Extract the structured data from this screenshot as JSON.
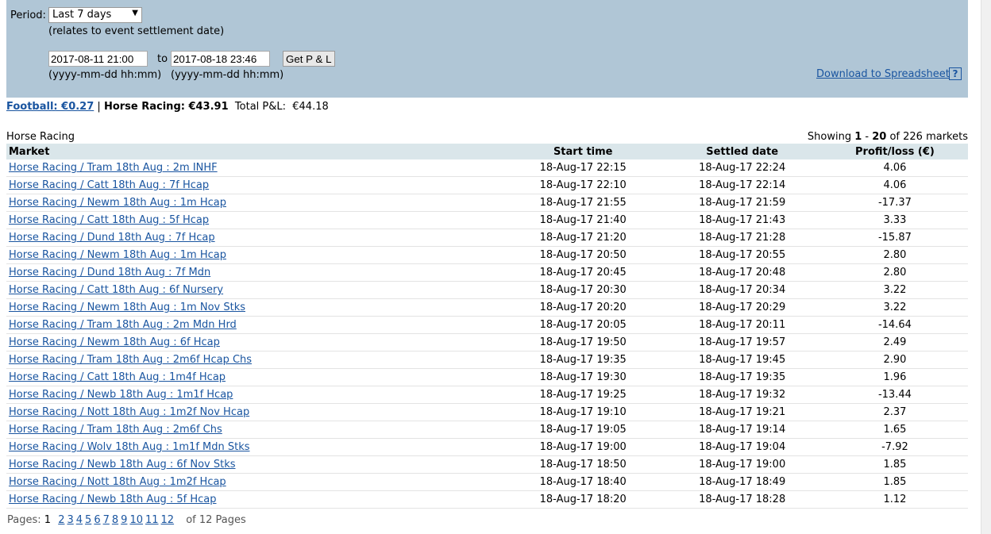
{
  "filter": {
    "period_label": "Period:",
    "period_value": "Last 7 days",
    "period_note": "(relates to event settlement date)",
    "from": "2017-08-11 21:00",
    "to_label": "to",
    "to": "2017-08-18 23:46",
    "format_hint": "(yyyy-mm-dd hh:mm)",
    "button": "Get P & L",
    "download": "Download to Spreadsheet",
    "help": "?"
  },
  "summary": {
    "football": "Football: €0.27",
    "sep": "|",
    "horse": "Horse Racing: €43.91",
    "total_label": "Total P&L:",
    "total": "€44.18"
  },
  "section": "Horse Racing",
  "showing": {
    "pre": "Showing ",
    "from": "1",
    "dash": " - ",
    "to": "20",
    "post": " of 226 markets"
  },
  "columns": [
    "Market",
    "Start time",
    "Settled date",
    "Profit/loss (€)"
  ],
  "rows": [
    [
      "Horse Racing / Tram 18th Aug : 2m INHF",
      "18-Aug-17 22:15",
      "18-Aug-17 22:24",
      "4.06"
    ],
    [
      "Horse Racing / Catt 18th Aug : 7f Hcap",
      "18-Aug-17 22:10",
      "18-Aug-17 22:14",
      "4.06"
    ],
    [
      "Horse Racing / Newm 18th Aug : 1m Hcap",
      "18-Aug-17 21:55",
      "18-Aug-17 21:59",
      "-17.37"
    ],
    [
      "Horse Racing / Catt 18th Aug : 5f Hcap",
      "18-Aug-17 21:40",
      "18-Aug-17 21:43",
      "3.33"
    ],
    [
      "Horse Racing / Dund 18th Aug : 7f Hcap",
      "18-Aug-17 21:20",
      "18-Aug-17 21:28",
      "-15.87"
    ],
    [
      "Horse Racing / Newm 18th Aug : 1m Hcap",
      "18-Aug-17 20:50",
      "18-Aug-17 20:55",
      "2.80"
    ],
    [
      "Horse Racing / Dund 18th Aug : 7f Mdn",
      "18-Aug-17 20:45",
      "18-Aug-17 20:48",
      "2.80"
    ],
    [
      "Horse Racing / Catt 18th Aug : 6f Nursery",
      "18-Aug-17 20:30",
      "18-Aug-17 20:34",
      "3.22"
    ],
    [
      "Horse Racing / Newm 18th Aug : 1m Nov Stks",
      "18-Aug-17 20:20",
      "18-Aug-17 20:29",
      "3.22"
    ],
    [
      "Horse Racing / Tram 18th Aug : 2m Mdn Hrd",
      "18-Aug-17 20:05",
      "18-Aug-17 20:11",
      "-14.64"
    ],
    [
      "Horse Racing / Newm 18th Aug : 6f Hcap",
      "18-Aug-17 19:50",
      "18-Aug-17 19:57",
      "2.49"
    ],
    [
      "Horse Racing / Tram 18th Aug : 2m6f Hcap Chs",
      "18-Aug-17 19:35",
      "18-Aug-17 19:45",
      "2.90"
    ],
    [
      "Horse Racing / Catt 18th Aug : 1m4f Hcap",
      "18-Aug-17 19:30",
      "18-Aug-17 19:35",
      "1.96"
    ],
    [
      "Horse Racing / Newb 18th Aug : 1m1f Hcap",
      "18-Aug-17 19:25",
      "18-Aug-17 19:32",
      "-13.44"
    ],
    [
      "Horse Racing / Nott 18th Aug : 1m2f Nov Hcap",
      "18-Aug-17 19:10",
      "18-Aug-17 19:21",
      "2.37"
    ],
    [
      "Horse Racing / Tram 18th Aug : 2m6f Chs",
      "18-Aug-17 19:05",
      "18-Aug-17 19:14",
      "1.65"
    ],
    [
      "Horse Racing / Wolv 18th Aug : 1m1f Mdn Stks",
      "18-Aug-17 19:00",
      "18-Aug-17 19:04",
      "-7.92"
    ],
    [
      "Horse Racing / Newb 18th Aug : 6f Nov Stks",
      "18-Aug-17 18:50",
      "18-Aug-17 19:00",
      "1.85"
    ],
    [
      "Horse Racing / Nott 18th Aug : 1m2f Hcap",
      "18-Aug-17 18:40",
      "18-Aug-17 18:49",
      "1.85"
    ],
    [
      "Horse Racing / Newb 18th Aug : 5f Hcap",
      "18-Aug-17 18:20",
      "18-Aug-17 18:28",
      "1.12"
    ]
  ],
  "pagination": {
    "label": "Pages:",
    "current": "1",
    "pages": [
      "2",
      "3",
      "4",
      "5",
      "6",
      "7",
      "8",
      "9",
      "10",
      "11",
      "12"
    ],
    "of": "of 12 Pages"
  }
}
